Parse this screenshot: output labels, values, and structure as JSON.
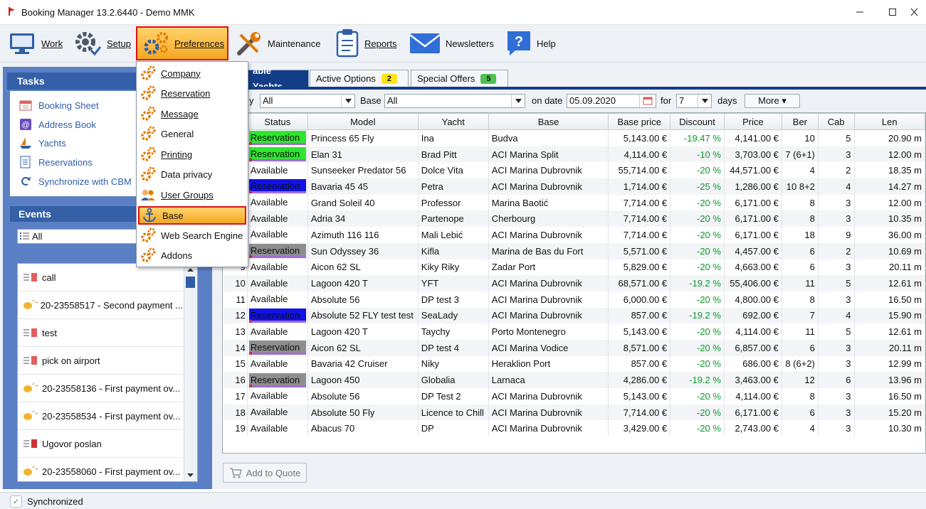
{
  "window": {
    "title": "Booking Manager 13.2.6440 - Demo MMK"
  },
  "toolbar": [
    {
      "label": "Work",
      "icon": "monitor-icon"
    },
    {
      "label": "Setup",
      "icon": "gear-icon"
    },
    {
      "label": "Preferences",
      "icon": "gears-icon"
    },
    {
      "label": "Maintenance",
      "icon": "wrench-icon"
    },
    {
      "label": "Reports",
      "icon": "clipboard-icon"
    },
    {
      "label": "Newsletters",
      "icon": "envelope-icon"
    },
    {
      "label": "Help",
      "icon": "help-icon"
    }
  ],
  "menu": {
    "items": [
      {
        "label": "Company"
      },
      {
        "label": "Reservation"
      },
      {
        "label": "Message"
      },
      {
        "label": "General"
      },
      {
        "label": "Printing"
      },
      {
        "label": "Data privacy"
      },
      {
        "label": "User Groups"
      },
      {
        "label": "Base"
      },
      {
        "label": "Web Search Engine"
      },
      {
        "label": "Addons"
      }
    ]
  },
  "tasks": {
    "title": "Tasks",
    "items": [
      {
        "label": "Booking Sheet"
      },
      {
        "label": "Address Book"
      },
      {
        "label": "Yachts"
      },
      {
        "label": "Reservations"
      },
      {
        "label": "Synchronize with CBM"
      }
    ]
  },
  "events": {
    "title": "Events",
    "filter": "All",
    "items": [
      {
        "label": "call"
      },
      {
        "label": "20-23558517 - Second payment ..."
      },
      {
        "label": "test"
      },
      {
        "label": "pick on airport"
      },
      {
        "label": "20-23558136 - First payment ov..."
      },
      {
        "label": "20-23558534 - First payment ov..."
      },
      {
        "label": "Ugovor poslan"
      },
      {
        "label": "20-23558060 - First payment ov..."
      }
    ]
  },
  "tabs": [
    {
      "label": "able Yachts",
      "badge": ""
    },
    {
      "label": "Active Options",
      "badge": "2"
    },
    {
      "label": "Special Offers",
      "badge": "5"
    }
  ],
  "filters": {
    "y_label": "y",
    "y_value": "All",
    "base_label": "Base",
    "base_value": "All",
    "ondate_label": "on date",
    "ondate_value": "05.09.2020",
    "for_label": "for",
    "for_value": "7",
    "days_label": "days",
    "more_label": "More ▾"
  },
  "table": {
    "columns": [
      "Status",
      "Model",
      "Yacht",
      "Base",
      "Base price",
      "Discount",
      "Price",
      "Ber",
      "Cab",
      "Len"
    ],
    "rows": [
      {
        "n": "",
        "status": "Reservation",
        "style": "res-green",
        "model": "Princess 65 Fly",
        "yacht": "Ina",
        "base": "Budva",
        "base_price": "5,143.00 €",
        "discount": "-19.47 %",
        "price": "4,141.00 €",
        "ber": "10",
        "cab": "5",
        "len": "20.90 m"
      },
      {
        "n": "",
        "status": "Reservation",
        "style": "res-green",
        "model": "Elan 31",
        "yacht": "Brad Pitt",
        "base": "ACI Marina Split",
        "base_price": "4,114.00 €",
        "discount": "-10 %",
        "price": "3,703.00 €",
        "ber": "7 (6+1)",
        "cab": "3",
        "len": "12.00 m"
      },
      {
        "n": "",
        "status": "Available",
        "style": "",
        "model": "Sunseeker Predator 56",
        "yacht": "Dolce Vita",
        "base": "ACI Marina Dubrovnik",
        "base_price": "55,714.00 €",
        "discount": "-20 %",
        "price": "44,571.00 €",
        "ber": "4",
        "cab": "2",
        "len": "18.35 m"
      },
      {
        "n": "",
        "status": "Reservation",
        "style": "res-blue",
        "model": "Bavaria 45 45",
        "yacht": "Petra",
        "base": "ACI Marina Dubrovnik",
        "base_price": "1,714.00 €",
        "discount": "-25 %",
        "price": "1,286.00 €",
        "ber": "10 8+2",
        "cab": "4",
        "len": "14.27 m"
      },
      {
        "n": "",
        "status": "Available",
        "style": "",
        "model": "Grand Soleil 40",
        "yacht": "Professor",
        "base": "Marina Baotić",
        "base_price": "7,714.00 €",
        "discount": "-20 %",
        "price": "6,171.00 €",
        "ber": "8",
        "cab": "3",
        "len": "12.00 m"
      },
      {
        "n": "",
        "status": "Available",
        "style": "",
        "model": "Adria 34",
        "yacht": "Partenope",
        "base": "Cherbourg",
        "base_price": "7,714.00 €",
        "discount": "-20 %",
        "price": "6,171.00 €",
        "ber": "8",
        "cab": "3",
        "len": "10.35 m"
      },
      {
        "n": "",
        "status": "Available",
        "style": "",
        "model": "Azimuth 116 116",
        "yacht": "Mali Lebić",
        "base": "ACI Marina Dubrovnik",
        "base_price": "7,714.00 €",
        "discount": "-20 %",
        "price": "6,171.00 €",
        "ber": "18",
        "cab": "9",
        "len": "36.00 m"
      },
      {
        "n": "",
        "status": "Reservation",
        "style": "res-gray",
        "model": "Sun Odyssey 36",
        "yacht": "Kifla",
        "base": "Marina de Bas du Fort",
        "base_price": "5,571.00 €",
        "discount": "-20 %",
        "price": "4,457.00 €",
        "ber": "6",
        "cab": "2",
        "len": "10.69 m"
      },
      {
        "n": "9",
        "status": "Available",
        "style": "",
        "model": "Aicon 62 SL",
        "yacht": "Kiky Riky",
        "base": "Zadar Port",
        "base_price": "5,829.00 €",
        "discount": "-20 %",
        "price": "4,663.00 €",
        "ber": "6",
        "cab": "3",
        "len": "20.11 m"
      },
      {
        "n": "10",
        "status": "Available",
        "style": "",
        "model": "Lagoon 420 T",
        "yacht": "YFT",
        "base": "ACI Marina Dubrovnik",
        "base_price": "68,571.00 €",
        "discount": "-19.2 %",
        "price": "55,406.00 €",
        "ber": "11",
        "cab": "5",
        "len": "12.61 m"
      },
      {
        "n": "11",
        "status": "Available",
        "style": "",
        "model": "Absolute 56",
        "yacht": "DP test 3",
        "base": "ACI Marina Dubrovnik",
        "base_price": "6,000.00 €",
        "discount": "-20 %",
        "price": "4,800.00 €",
        "ber": "8",
        "cab": "3",
        "len": "16.50 m"
      },
      {
        "n": "12",
        "status": "Reservation",
        "style": "res-blue",
        "model": "Absolute 52 FLY test test",
        "yacht": "SeaLady",
        "base": "ACI Marina Dubrovnik",
        "base_price": "857.00 €",
        "discount": "-19.2 %",
        "price": "692.00 €",
        "ber": "7",
        "cab": "4",
        "len": "15.90 m"
      },
      {
        "n": "13",
        "status": "Available",
        "style": "",
        "model": "Lagoon 420 T",
        "yacht": "Taychy",
        "base": "Porto Montenegro",
        "base_price": "5,143.00 €",
        "discount": "-20 %",
        "price": "4,114.00 €",
        "ber": "11",
        "cab": "5",
        "len": "12.61 m"
      },
      {
        "n": "14",
        "status": "Reservation",
        "style": "res-gray",
        "model": "Aicon 62 SL",
        "yacht": "DP test 4",
        "base": "ACI Marina Vodice",
        "base_price": "8,571.00 €",
        "discount": "-20 %",
        "price": "6,857.00 €",
        "ber": "6",
        "cab": "3",
        "len": "20.11 m"
      },
      {
        "n": "15",
        "status": "Available",
        "style": "",
        "model": "Bavaria 42 Cruiser",
        "yacht": "Niky",
        "base": "Heraklion Port",
        "base_price": "857.00 €",
        "discount": "-20 %",
        "price": "686.00 €",
        "ber": "8 (6+2)",
        "cab": "3",
        "len": "12.99 m"
      },
      {
        "n": "16",
        "status": "Reservation",
        "style": "res-gray",
        "model": "Lagoon 450",
        "yacht": "Globalia",
        "base": "Larnaca",
        "base_price": "4,286.00 €",
        "discount": "-19.2 %",
        "price": "3,463.00 €",
        "ber": "12",
        "cab": "6",
        "len": "13.96 m"
      },
      {
        "n": "17",
        "status": "Available",
        "style": "",
        "model": "Absolute 56",
        "yacht": "DP Test 2",
        "base": "ACI Marina Dubrovnik",
        "base_price": "5,143.00 €",
        "discount": "-20 %",
        "price": "4,114.00 €",
        "ber": "8",
        "cab": "3",
        "len": "16.50 m"
      },
      {
        "n": "18",
        "status": "Available",
        "style": "",
        "model": "Absolute 50 Fly",
        "yacht": "Licence to Chill",
        "base": "ACI Marina Dubrovnik",
        "base_price": "7,714.00 €",
        "discount": "-20 %",
        "price": "6,171.00 €",
        "ber": "6",
        "cab": "3",
        "len": "15.20 m"
      },
      {
        "n": "19",
        "status": "Available",
        "style": "",
        "model": "Abacus 70",
        "yacht": "DP",
        "base": "ACI Marina Dubrovnik",
        "base_price": "3,429.00 €",
        "discount": "-20 %",
        "price": "2,743.00 €",
        "ber": "4",
        "cab": "3",
        "len": "10.30 m"
      }
    ]
  },
  "bottom": {
    "add_to_quote": "Add to Quote"
  },
  "statusbar": {
    "text": "Synchronized"
  }
}
